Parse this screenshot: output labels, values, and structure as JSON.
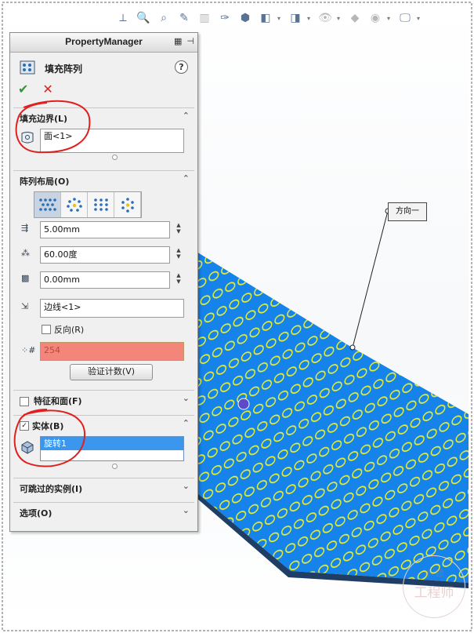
{
  "property_manager": {
    "header_title": "PropertyManager",
    "feature_name": "填充阵列",
    "help_label": "?",
    "ok_symbol": "✔",
    "cancel_symbol": "✕"
  },
  "sections": {
    "fill_boundary": {
      "title": "填充边界(L)",
      "selection": "面<1>"
    },
    "pattern_layout": {
      "title": "阵列布局(O)",
      "spacing": "5.00mm",
      "angle": "60.00度",
      "margin": "0.00mm",
      "direction": "边线<1>",
      "reverse_label": "反向(R)",
      "instance_count": "254",
      "verify_button": "验证计数(V)"
    },
    "features_faces": {
      "title": "特征和面(F)"
    },
    "bodies": {
      "title": "实体(B)",
      "checked": true,
      "selection": "旋转1"
    },
    "skip_instances": {
      "title": "可跳过的实例(I)"
    },
    "options": {
      "title": "选项(O)"
    }
  },
  "viewport": {
    "callout_label": "方向一",
    "watermark_small": "小 硕",
    "watermark_large": "工程师"
  },
  "colors": {
    "plate_blue": "#1583ea",
    "hole_yellow": "#e7ef2f",
    "count_field": "#f4857a",
    "selection_blue": "#3b97ee",
    "annotation_red": "#e0201e"
  }
}
